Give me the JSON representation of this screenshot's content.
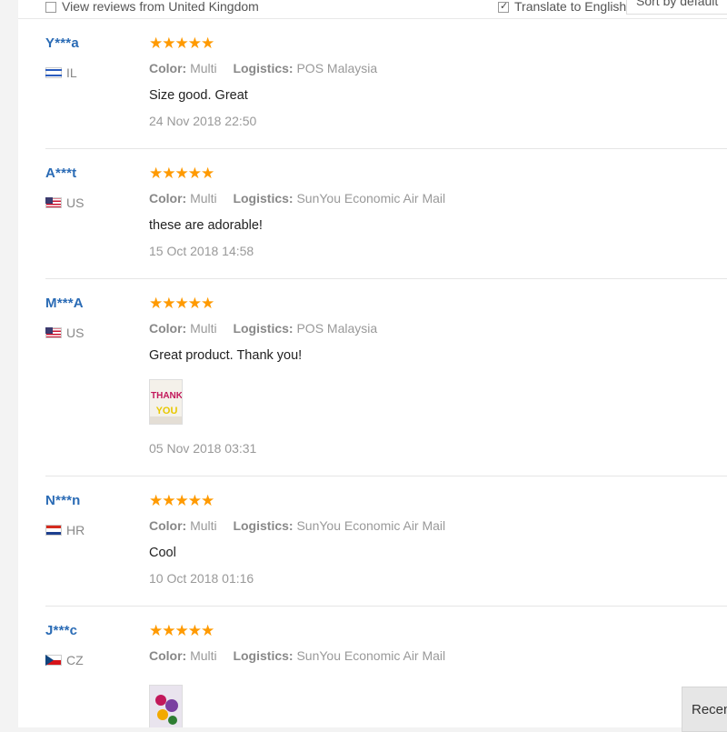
{
  "filter": {
    "view_reviews_label": "View reviews from United Kingdom",
    "translate_label": "Translate to English",
    "sort_label": "Sort by default"
  },
  "color_key": "Color:",
  "logistics_key": "Logistics:",
  "reviews": [
    {
      "user": "Y***a",
      "country": "IL",
      "stars": "★★★★★",
      "color": "Multi",
      "logistics": "POS Malaysia",
      "text": "Size good. Great",
      "date": "24 Nov 2018 22:50"
    },
    {
      "user": "A***t",
      "country": "US",
      "stars": "★★★★★",
      "color": "Multi",
      "logistics": "SunYou Economic Air Mail",
      "text": "these are adorable!",
      "date": "15 Oct 2018 14:58"
    },
    {
      "user": "M***A",
      "country": "US",
      "stars": "★★★★★",
      "color": "Multi",
      "logistics": "POS Malaysia",
      "text": "Great product. Thank you!",
      "date": "05 Nov 2018 03:31",
      "photo_text": [
        "THANK",
        "YOU"
      ]
    },
    {
      "user": "N***n",
      "country": "HR",
      "stars": "★★★★★",
      "color": "Multi",
      "logistics": "SunYou Economic Air Mail",
      "text": "Cool",
      "date": "10 Oct 2018 01:16"
    },
    {
      "user": "J***c",
      "country": "CZ",
      "stars": "★★★★★",
      "color": "Multi",
      "logistics": "SunYou Economic Air Mail",
      "text": "",
      "date": ""
    }
  ],
  "recent_button": "Recent",
  "colors": {
    "username": "#2a6bb5",
    "star": "#ff9a00",
    "muted": "#999999"
  }
}
